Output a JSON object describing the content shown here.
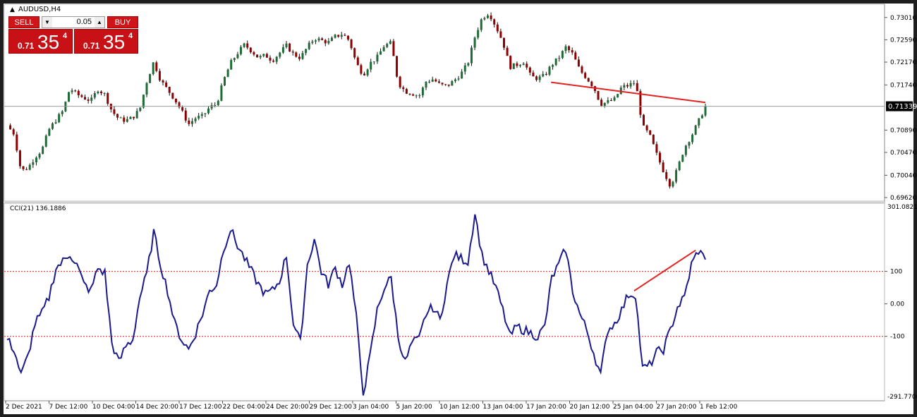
{
  "symbol_title": "AUDUSD,H4",
  "trade_panel": {
    "sell_label": "SELL",
    "buy_label": "BUY",
    "lot_value": "0.05",
    "sell_price": {
      "small": "0.71",
      "big": "35",
      "sup": "4"
    },
    "buy_price": {
      "small": "0.71",
      "big": "35",
      "sup": "4"
    }
  },
  "colors": {
    "chart_bg": "#ffffff",
    "up_candle": "#1e6b36",
    "down_candle": "#8b0000",
    "cci_line": "#1a1a8c",
    "trendline": "#e32222",
    "level_line": "#e32222",
    "current_price_bg": "#000000"
  },
  "chart_data": [
    {
      "type": "candlestick",
      "title": "AUDUSD,H4",
      "ylim": [
        0.6962,
        0.7318
      ],
      "y_ticks": [
        "0.73010",
        "0.72590",
        "0.72170",
        "0.71740",
        "0.70890",
        "0.70470",
        "0.70040",
        "0.69620"
      ],
      "current_price_label": "0.71339",
      "current_price": 0.71339,
      "trendline": {
        "from": {
          "x": 0.779,
          "y": 0.7179
        },
        "to": {
          "x": 1.0,
          "y": 0.7141
        }
      },
      "grid": false,
      "path_points": [
        [
          0.0,
          0.7098
        ],
        [
          0.01,
          0.7082
        ],
        [
          0.02,
          0.7012
        ],
        [
          0.03,
          0.7018
        ],
        [
          0.04,
          0.7038
        ],
        [
          0.05,
          0.7052
        ],
        [
          0.06,
          0.709
        ],
        [
          0.07,
          0.7108
        ],
        [
          0.08,
          0.7125
        ],
        [
          0.09,
          0.7168
        ],
        [
          0.1,
          0.7156
        ],
        [
          0.11,
          0.715
        ],
        [
          0.12,
          0.7144
        ],
        [
          0.13,
          0.7166
        ],
        [
          0.14,
          0.7156
        ],
        [
          0.15,
          0.7125
        ],
        [
          0.16,
          0.711
        ],
        [
          0.17,
          0.7107
        ],
        [
          0.18,
          0.7113
        ],
        [
          0.19,
          0.7128
        ],
        [
          0.2,
          0.718
        ],
        [
          0.21,
          0.7218
        ],
        [
          0.22,
          0.7182
        ],
        [
          0.23,
          0.7165
        ],
        [
          0.24,
          0.7147
        ],
        [
          0.25,
          0.7125
        ],
        [
          0.26,
          0.71
        ],
        [
          0.27,
          0.7112
        ],
        [
          0.28,
          0.7115
        ],
        [
          0.29,
          0.7132
        ],
        [
          0.3,
          0.7138
        ],
        [
          0.31,
          0.7182
        ],
        [
          0.32,
          0.7215
        ],
        [
          0.33,
          0.7234
        ],
        [
          0.34,
          0.725
        ],
        [
          0.35,
          0.7238
        ],
        [
          0.36,
          0.7225
        ],
        [
          0.37,
          0.723
        ],
        [
          0.38,
          0.722
        ],
        [
          0.39,
          0.7234
        ],
        [
          0.4,
          0.7248
        ],
        [
          0.41,
          0.7232
        ],
        [
          0.42,
          0.7225
        ],
        [
          0.43,
          0.7245
        ],
        [
          0.44,
          0.7262
        ],
        [
          0.45,
          0.7258
        ],
        [
          0.46,
          0.7254
        ],
        [
          0.47,
          0.7265
        ],
        [
          0.48,
          0.727
        ],
        [
          0.49,
          0.7258
        ],
        [
          0.5,
          0.7215
        ],
        [
          0.51,
          0.7193
        ],
        [
          0.52,
          0.7215
        ],
        [
          0.53,
          0.7226
        ],
        [
          0.54,
          0.7248
        ],
        [
          0.55,
          0.7253
        ],
        [
          0.56,
          0.7178
        ],
        [
          0.57,
          0.7162
        ],
        [
          0.58,
          0.7158
        ],
        [
          0.59,
          0.7153
        ],
        [
          0.6,
          0.718
        ],
        [
          0.61,
          0.7185
        ],
        [
          0.62,
          0.7174
        ],
        [
          0.63,
          0.7172
        ],
        [
          0.64,
          0.7182
        ],
        [
          0.65,
          0.7195
        ],
        [
          0.66,
          0.7215
        ],
        [
          0.67,
          0.7265
        ],
        [
          0.68,
          0.73
        ],
        [
          0.69,
          0.731
        ],
        [
          0.7,
          0.7284
        ],
        [
          0.71,
          0.7255
        ],
        [
          0.72,
          0.7208
        ],
        [
          0.73,
          0.7212
        ],
        [
          0.74,
          0.7218
        ],
        [
          0.75,
          0.719
        ],
        [
          0.76,
          0.7186
        ],
        [
          0.77,
          0.7192
        ],
        [
          0.78,
          0.7212
        ],
        [
          0.79,
          0.7225
        ],
        [
          0.8,
          0.7245
        ],
        [
          0.81,
          0.7232
        ],
        [
          0.82,
          0.7202
        ],
        [
          0.83,
          0.7187
        ],
        [
          0.84,
          0.717
        ],
        [
          0.85,
          0.7138
        ],
        [
          0.86,
          0.7142
        ],
        [
          0.87,
          0.7147
        ],
        [
          0.88,
          0.717
        ],
        [
          0.89,
          0.7173
        ],
        [
          0.9,
          0.718
        ],
        [
          0.91,
          0.7096
        ],
        [
          0.92,
          0.708
        ],
        [
          0.93,
          0.7044
        ],
        [
          0.94,
          0.7012
        ],
        [
          0.95,
          0.6984
        ],
        [
          0.96,
          0.7016
        ],
        [
          0.97,
          0.7056
        ],
        [
          0.98,
          0.7078
        ],
        [
          0.99,
          0.7105
        ],
        [
          1.0,
          0.71339
        ]
      ]
    },
    {
      "type": "line",
      "title": "CCI(21) 136.1886",
      "ylim": [
        -291.7706,
        301.0821
      ],
      "y_tick_labels": {
        "top": "301.0821",
        "bottom": "-291.7706",
        "levels": [
          "100",
          "0.00",
          "-100"
        ]
      },
      "levels": [
        100,
        0,
        -100
      ],
      "y_ticks": [
        100,
        0,
        -100
      ],
      "x_tick_labels": [
        "2 Dec 2021",
        "7 Dec 12:00",
        "10 Dec 04:00",
        "14 Dec 20:00",
        "17 Dec 12:00",
        "22 Dec 04:00",
        "24 Dec 20:00",
        "29 Dec 12:00",
        "3 Jan 04:00",
        "5 Jan 20:00",
        "10 Jan 12:00",
        "13 Jan 04:00",
        "17 Jan 20:00",
        "20 Jan 12:00",
        "25 Jan 04:00",
        "27 Jan 20:00",
        "1 Feb 12:00"
      ],
      "trendline": {
        "from": {
          "x": 0.898,
          "y": 40
        },
        "to": {
          "x": 0.986,
          "y": 165
        }
      },
      "series": [
        {
          "name": "CCI(21)",
          "points": [
            [
              0.0,
              -110
            ],
            [
              0.01,
              -140
            ],
            [
              0.02,
              -220
            ],
            [
              0.03,
              -160
            ],
            [
              0.04,
              -60
            ],
            [
              0.05,
              -30
            ],
            [
              0.06,
              20
            ],
            [
              0.07,
              110
            ],
            [
              0.08,
              130
            ],
            [
              0.09,
              155
            ],
            [
              0.1,
              120
            ],
            [
              0.11,
              60
            ],
            [
              0.12,
              40
            ],
            [
              0.13,
              110
            ],
            [
              0.14,
              95
            ],
            [
              0.15,
              -120
            ],
            [
              0.16,
              -180
            ],
            [
              0.17,
              -130
            ],
            [
              0.18,
              -110
            ],
            [
              0.19,
              20
            ],
            [
              0.2,
              90
            ],
            [
              0.21,
              220
            ],
            [
              0.22,
              120
            ],
            [
              0.23,
              40
            ],
            [
              0.24,
              -60
            ],
            [
              0.25,
              -110
            ],
            [
              0.26,
              -140
            ],
            [
              0.27,
              -90
            ],
            [
              0.28,
              -30
            ],
            [
              0.29,
              40
            ],
            [
              0.3,
              60
            ],
            [
              0.31,
              170
            ],
            [
              0.32,
              230
            ],
            [
              0.33,
              180
            ],
            [
              0.34,
              140
            ],
            [
              0.35,
              100
            ],
            [
              0.36,
              60
            ],
            [
              0.37,
              30
            ],
            [
              0.38,
              40
            ],
            [
              0.39,
              70
            ],
            [
              0.4,
              150
            ],
            [
              0.41,
              -60
            ],
            [
              0.42,
              -120
            ],
            [
              0.43,
              120
            ],
            [
              0.44,
              200
            ],
            [
              0.45,
              100
            ],
            [
              0.46,
              60
            ],
            [
              0.47,
              110
            ],
            [
              0.48,
              60
            ],
            [
              0.49,
              130
            ],
            [
              0.5,
              -40
            ],
            [
              0.51,
              -280
            ],
            [
              0.52,
              -160
            ],
            [
              0.53,
              -20
            ],
            [
              0.54,
              50
            ],
            [
              0.55,
              80
            ],
            [
              0.56,
              -100
            ],
            [
              0.57,
              -180
            ],
            [
              0.58,
              -120
            ],
            [
              0.59,
              -110
            ],
            [
              0.6,
              -30
            ],
            [
              0.61,
              -10
            ],
            [
              0.62,
              -50
            ],
            [
              0.63,
              60
            ],
            [
              0.64,
              150
            ],
            [
              0.65,
              140
            ],
            [
              0.66,
              130
            ],
            [
              0.67,
              280
            ],
            [
              0.68,
              150
            ],
            [
              0.69,
              100
            ],
            [
              0.7,
              50
            ],
            [
              0.71,
              -20
            ],
            [
              0.72,
              -100
            ],
            [
              0.73,
              -70
            ],
            [
              0.74,
              -80
            ],
            [
              0.75,
              -90
            ],
            [
              0.76,
              -100
            ],
            [
              0.77,
              -70
            ],
            [
              0.78,
              80
            ],
            [
              0.79,
              120
            ],
            [
              0.8,
              170
            ],
            [
              0.81,
              40
            ],
            [
              0.82,
              -30
            ],
            [
              0.83,
              -80
            ],
            [
              0.84,
              -150
            ],
            [
              0.85,
              -220
            ],
            [
              0.86,
              -80
            ],
            [
              0.87,
              -60
            ],
            [
              0.88,
              -20
            ],
            [
              0.89,
              30
            ],
            [
              0.9,
              30
            ],
            [
              0.91,
              -200
            ],
            [
              0.92,
              -190
            ],
            [
              0.93,
              -150
            ],
            [
              0.94,
              -140
            ],
            [
              0.95,
              -80
            ],
            [
              0.96,
              -10
            ],
            [
              0.97,
              20
            ],
            [
              0.98,
              120
            ],
            [
              0.99,
              165
            ],
            [
              1.0,
              136.1886
            ]
          ]
        }
      ]
    }
  ]
}
